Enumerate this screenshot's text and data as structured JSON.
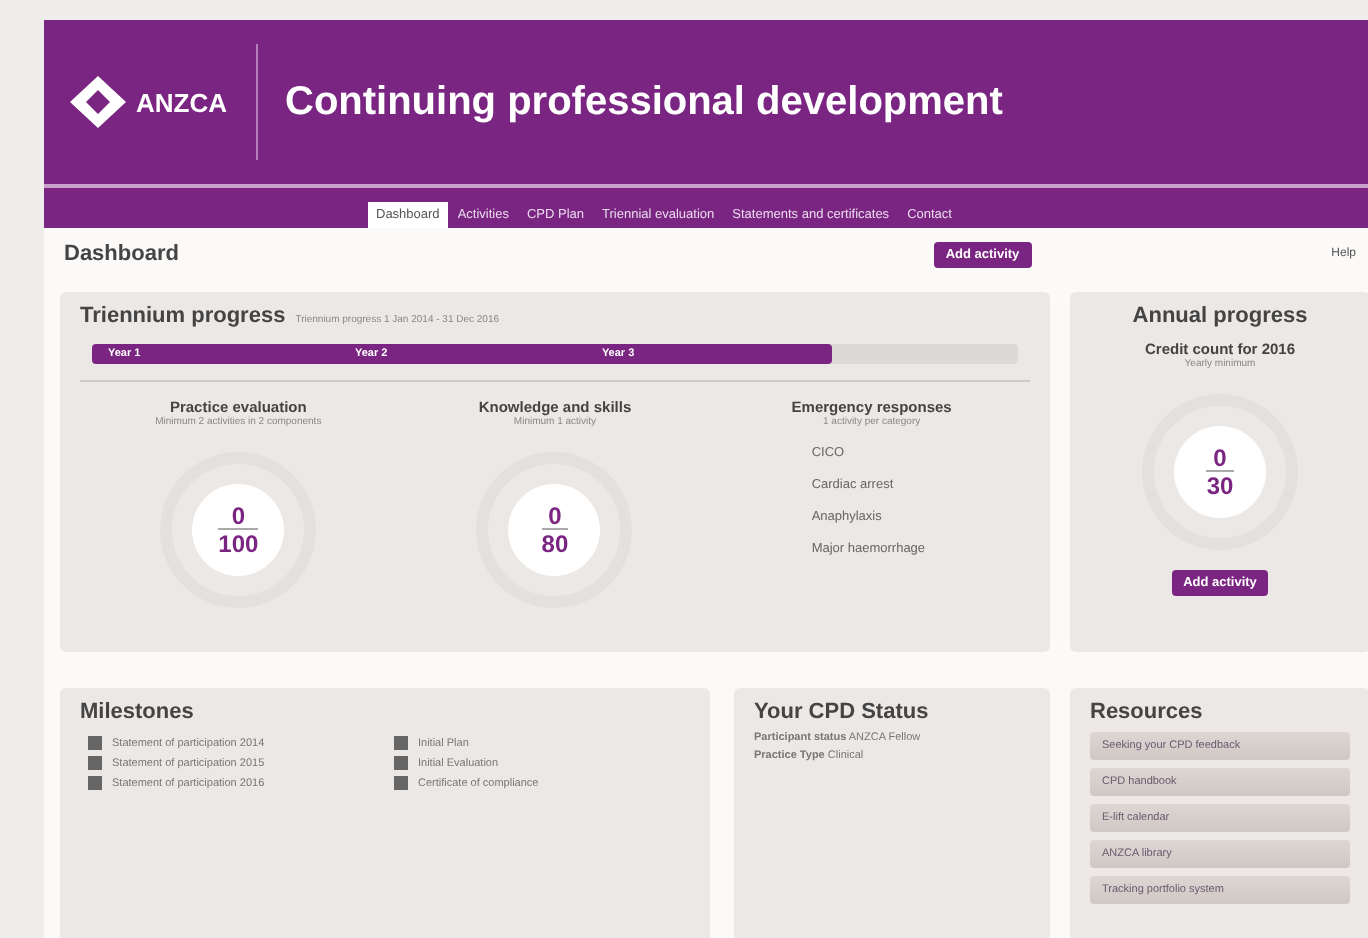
{
  "header": {
    "logo": "ANZCA",
    "title": "Continuing professional development"
  },
  "nav": [
    {
      "label": "Dashboard",
      "selected": true
    },
    {
      "label": "Activities",
      "selected": false
    },
    {
      "label": "CPD Plan",
      "selected": false
    },
    {
      "label": "Triennial evaluation",
      "selected": false
    },
    {
      "label": "Statements and certificates",
      "selected": false
    },
    {
      "label": "Contact",
      "selected": false
    }
  ],
  "page_title": "Dashboard",
  "add_button": "Add activity",
  "help_link": "Help",
  "triennium": {
    "title": "Triennium progress",
    "subtitle": "Triennium progress 1 Jan 2014 - 31 Dec 2016",
    "years": [
      "Year 1",
      "Year 2",
      "Year 3"
    ],
    "level": 0.8,
    "sections": [
      {
        "kind": "gauge",
        "title": "Practice evaluation",
        "note": "Minimum 2 activities in 2 components",
        "value": "0",
        "target": "100"
      },
      {
        "kind": "gauge",
        "title": "Knowledge and skills",
        "note": "Minimum 1 activity",
        "value": "0",
        "target": "80"
      },
      {
        "kind": "list",
        "title": "Emergency responses",
        "note": "1 activity per category",
        "items": [
          "CICO",
          "Cardiac arrest",
          "Anaphylaxis",
          "Major haemorrhage"
        ]
      }
    ]
  },
  "annual": {
    "title": "Annual progress",
    "subtitle": "Credit count for 2016",
    "note": "Yearly minimum",
    "value": "0",
    "target": "30",
    "button": "Add activity"
  },
  "milestones": {
    "title": "Milestones",
    "items": [
      {
        "label": "Statement of participation 2014",
        "checked": true
      },
      {
        "label": "Statement of participation 2015",
        "checked": true
      },
      {
        "label": "Statement of participation 2016",
        "checked": true
      },
      {
        "label": "Initial Plan",
        "checked": true
      },
      {
        "label": "Initial Evaluation",
        "checked": true
      },
      {
        "label": "Certificate of compliance",
        "checked": true
      }
    ]
  },
  "status": {
    "title": "Your CPD Status",
    "rows": [
      {
        "label": "Participant status",
        "value": "ANZCA Fellow"
      },
      {
        "label": "Practice Type",
        "value": "Clinical"
      }
    ]
  },
  "resources": {
    "title": "Resources",
    "links": [
      "Seeking your CPD feedback",
      "CPD handbook",
      "E-lift calendar",
      "ANZCA library",
      "Tracking portfolio system"
    ]
  }
}
